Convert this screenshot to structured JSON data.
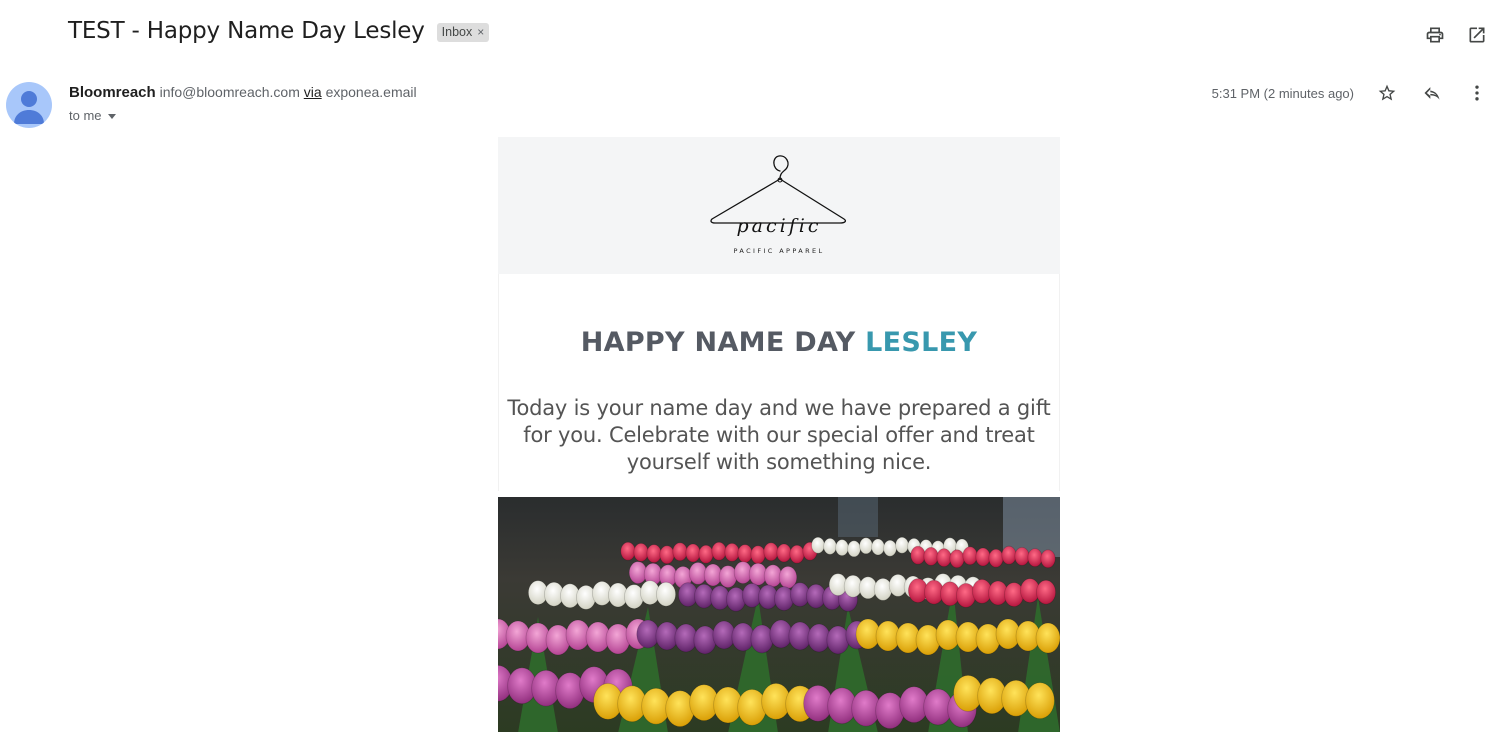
{
  "message": {
    "subject": "TEST - Happy Name Day Lesley",
    "label": "Inbox",
    "label_remove_glyph": "×"
  },
  "sender": {
    "name": "Bloomreach",
    "email": "info@bloomreach.com",
    "via_label": "via",
    "via_domain": "exponea.email",
    "to_label": "to me",
    "timestamp": "5:31 PM (2 minutes ago)"
  },
  "icons": {
    "print": "print-icon",
    "open_new_window": "open-in-new-window-icon",
    "star": "star-icon",
    "reply": "reply-icon",
    "more": "more-vertical-icon",
    "avatar": "person-avatar-icon",
    "logo": "clothes-hanger-logo"
  },
  "newsletter": {
    "logo_script": "pacific",
    "brand": "PACIFIC APPAREL",
    "headline_prefix": "HAPPY NAME DAY",
    "headline_name": "LESLEY",
    "body_lines": [
      "Today is your name day and we have prepared a gift",
      "for you. Celebrate with our special offer and treat",
      "yourself with something nice."
    ],
    "hero_alt": "tulip bouquets"
  },
  "colors": {
    "accent": "#3898ae",
    "headline": "#555a63",
    "logo_band": "#f4f5f6",
    "avatar_bg": "#a8c7fa",
    "avatar_fg": "#4f7bd8"
  }
}
